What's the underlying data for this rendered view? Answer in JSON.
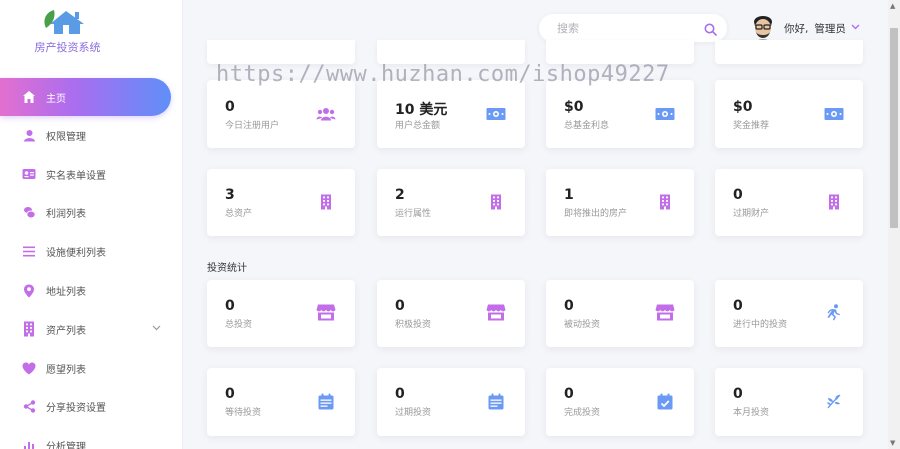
{
  "app": {
    "title": "房产投资系统",
    "watermark": "https://www.huzhan.com/ishop49227"
  },
  "colors": {
    "accent_purple": "#a56ef0",
    "accent_blue": "#5f8ff8",
    "icon_purple": "#c26ee8",
    "icon_blue": "#6b9af5"
  },
  "sidebar": {
    "items": [
      {
        "label": "主页",
        "icon": "home-icon",
        "active": true
      },
      {
        "label": "权限管理",
        "icon": "user-icon"
      },
      {
        "label": "实名表单设置",
        "icon": "id-card-icon"
      },
      {
        "label": "利润列表",
        "icon": "coins-icon"
      },
      {
        "label": "设施便利列表",
        "icon": "list-icon"
      },
      {
        "label": "地址列表",
        "icon": "map-pin-icon"
      },
      {
        "label": "资产列表",
        "icon": "building-icon",
        "has_submenu": true
      },
      {
        "label": "愿望列表",
        "icon": "heart-icon"
      },
      {
        "label": "分享投资设置",
        "icon": "share-icon"
      },
      {
        "label": "分析管理",
        "icon": "bar-chart-icon"
      }
    ]
  },
  "header": {
    "search_placeholder": "搜索",
    "greeting": "你好,",
    "user_name": "管理员"
  },
  "stats_row1": [
    {
      "value": "0",
      "label": "今日注册用户",
      "icon": "users-icon"
    },
    {
      "value": "10 美元",
      "label": "用户总金额",
      "icon": "money-icon"
    },
    {
      "value": "$0",
      "label": "总基金利息",
      "icon": "money-icon"
    },
    {
      "value": "$0",
      "label": "奖金推荐",
      "icon": "money-icon"
    }
  ],
  "stats_row2": [
    {
      "value": "3",
      "label": "总资产",
      "icon": "building-icon"
    },
    {
      "value": "2",
      "label": "运行属性",
      "icon": "building-icon"
    },
    {
      "value": "1",
      "label": "即将推出的房产",
      "icon": "building-icon"
    },
    {
      "value": "0",
      "label": "过期财产",
      "icon": "building-icon"
    }
  ],
  "investment": {
    "title": "投资统计",
    "row1": [
      {
        "value": "0",
        "label": "总投资",
        "icon": "store-icon"
      },
      {
        "value": "0",
        "label": "积极投资",
        "icon": "store-icon"
      },
      {
        "value": "0",
        "label": "被动投资",
        "icon": "store-icon"
      },
      {
        "value": "0",
        "label": "进行中的投资",
        "icon": "running-icon"
      }
    ],
    "row2": [
      {
        "value": "0",
        "label": "等待投资",
        "icon": "calendar-icon"
      },
      {
        "value": "0",
        "label": "过期投资",
        "icon": "calendar-icon"
      },
      {
        "value": "0",
        "label": "完成投资",
        "icon": "calendar-check-icon"
      },
      {
        "value": "0",
        "label": "本月投资",
        "icon": "leaf-icon"
      }
    ]
  }
}
